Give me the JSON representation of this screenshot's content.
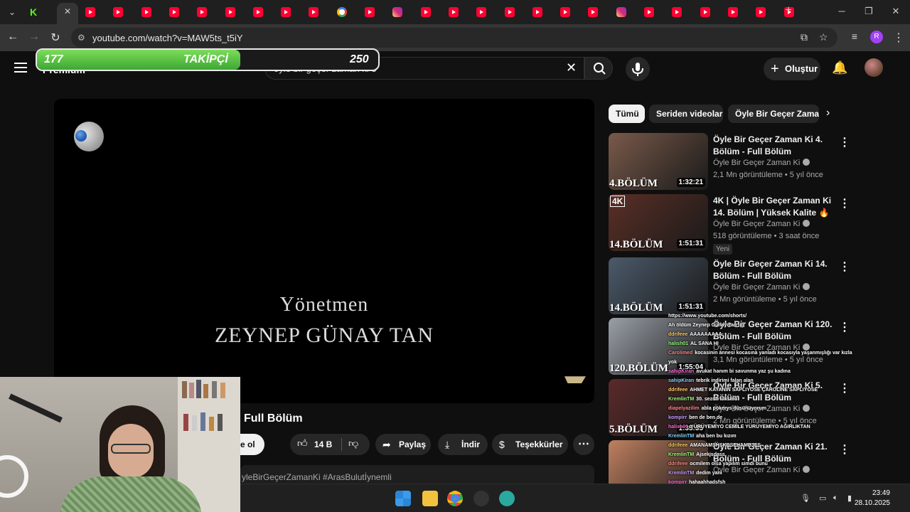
{
  "browser": {
    "url": "youtube.com/watch?v=MAW5ts_t5iY",
    "profile_initial": "R"
  },
  "overlay": {
    "current_followers": "177",
    "label": "TAKİPÇİ",
    "goal": "250",
    "progress": 0.708
  },
  "header": {
    "logo_text": "Premium",
    "search_query": "öyle bir geçer zaman ki 3",
    "create_label": "Oluştur"
  },
  "player": {
    "credit_line1": "Yönetmen",
    "credit_line2": "ZEYNEP GÜNAY TAN"
  },
  "video": {
    "title": "Full Bölüm",
    "subscribe_label": "e ol",
    "like_count": "14 B",
    "share_label": "Paylaş",
    "download_label": "İndir",
    "thanks_label": "Teşekkürler",
    "hashtags": "yleBirGeçerZamanKi #ArasBulutİynemli"
  },
  "chips": [
    "Tümü",
    "Seriden videolar",
    "Öyle Bir Geçer Zaman"
  ],
  "recommendations": [
    {
      "title": "Öyle Bir Geçer Zaman Ki 4. Bölüm - Full Bölüm",
      "channel": "Öyle Bir Geçer Zaman Ki",
      "meta": "2,1 Mn görüntüleme • 5 yıl önce",
      "duration": "1:32:21",
      "episode": "4.BÖLÜM",
      "badge": "",
      "is4k": "",
      "thumb_color": "#7a5a4a"
    },
    {
      "title": "4K | Öyle Bir Geçer Zaman Ki 14. Bölüm | Yüksek Kalite 🔥",
      "channel": "Öyle Bir Geçer Zaman Ki",
      "meta": "518 görüntüleme • 3 saat önce",
      "duration": "1:51:31",
      "episode": "14.BÖLÜM",
      "badge": "Yeni",
      "is4k": "4K",
      "thumb_color": "#5a2f26"
    },
    {
      "title": "Öyle Bir Geçer Zaman Ki 14. Bölüm - Full Bölüm",
      "channel": "Öyle Bir Geçer Zaman Ki",
      "meta": "2 Mn görüntüleme • 5 yıl önce",
      "duration": "1:51:31",
      "episode": "14.BÖLÜM",
      "badge": "",
      "is4k": "",
      "thumb_color": "#4b5a6a"
    },
    {
      "title": "Öyle Bir Geçer Zaman Ki 120. Bölüm - Full Bölüm",
      "channel": "Öyle Bir Geçer Zaman Ki",
      "meta": "3,1 Mn görüntüleme • 5 yıl önce",
      "duration": "1:55:04",
      "episode": "120.BÖLÜM",
      "badge": "",
      "is4k": "",
      "thumb_color": "#9aa0a8"
    },
    {
      "title": "Öyle Bir Geçer Zaman Ki 5. Bölüm - Full Bölüm",
      "channel": "Öyle Bir Geçer Zaman Ki",
      "meta": "2 Mn görüntüleme • 5 yıl önce",
      "duration": "1:35:35",
      "episode": "5.BÖLÜM",
      "badge": "",
      "is4k": "",
      "thumb_color": "#5a2a2a"
    },
    {
      "title": "Öyle Bir Geçer Zaman Ki 21. Bölüm - Full Bölüm",
      "channel": "Öyle Bir Geçer Zaman Ki",
      "meta": "",
      "duration": "",
      "episode": "",
      "badge": "",
      "is4k": "",
      "thumb_color": "#c08060"
    }
  ],
  "chat": [
    {
      "user": "",
      "text": "https://www.youtube.com/shorts/"
    },
    {
      "user": "",
      "text": "Ah öldüm Zeynep Günay Tan :(("
    },
    {
      "user": "ddrifeee",
      "text": "AAAAAAAAA"
    },
    {
      "user": "halish01",
      "text": "AL SANA HI"
    },
    {
      "user": "Carolimed",
      "text": "kocasinin annesi kocasına yanladı kocasıyla yaşanmışlığı var kızla"
    },
    {
      "user": "",
      "text": "yok"
    },
    {
      "user": "sahipKiran",
      "text": "avukat hanım bi savunma yaz şu kadına"
    },
    {
      "user": "sahipKiran",
      "text": "tebrik indirimi falan alan"
    },
    {
      "user": "ddrifeee",
      "text": "AHMET KAYANIN SAPLIYOSE ÇAROLINE SAPLIYOSE"
    },
    {
      "user": "KremlinTM",
      "text": "30. sezon lüksmü"
    },
    {
      "user": "diapelyazilim",
      "text": "abla pokerys düşünüyorum"
    },
    {
      "user": "kompirr",
      "text": "ben de ben de"
    },
    {
      "user": "halish01",
      "text": "YÜRÜYEMİYO CEMİLE YÜRÜYEMİYO AĞIRLIKTAN"
    },
    {
      "user": "KremlinTM",
      "text": "aha ben bu kızım"
    },
    {
      "user": "ddrifeee",
      "text": "AMANAMSHSKBSEHAMBJES"
    },
    {
      "user": "KremlinTM",
      "text": "Ajsekjsdass"
    },
    {
      "user": "ddrifeee",
      "text": "ocmilem olsa yapılım simdi bunu"
    },
    {
      "user": "KremlinTM",
      "text": "dedim yani"
    },
    {
      "user": "kompirr",
      "text": "hahaahhadsfsh"
    },
    {
      "user": "barisyigit",
      "text": "bu çocuk gibi zekadır am sehesye!"
    },
    {
      "user": "sahipKiran",
      "text": "karolin ölmez ama ölürse dizi biter"
    }
  ],
  "taskbar": {
    "time": "23:49",
    "date": "28.10.2025"
  },
  "colors": {
    "youtube_red": "#ff0033",
    "progress_green": "#53c23c",
    "background": "#0f0f0f"
  }
}
